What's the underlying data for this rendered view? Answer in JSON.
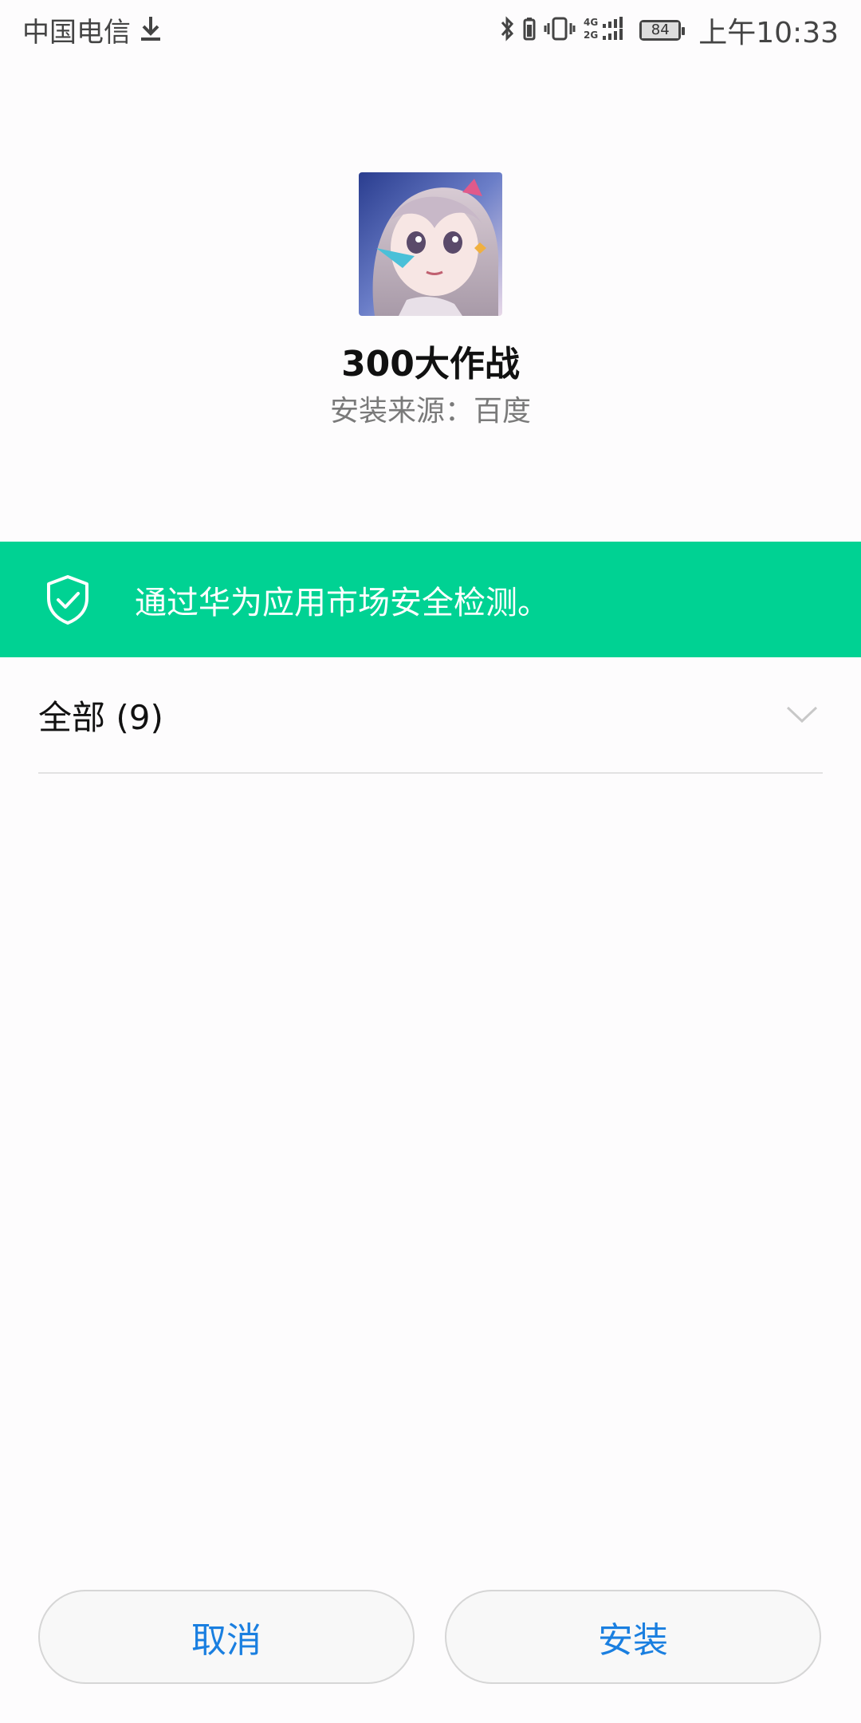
{
  "status_bar": {
    "carrier": "中国电信",
    "battery": "84",
    "time": "上午10:33",
    "network": "4G 2G"
  },
  "app": {
    "name": "300大作战",
    "install_source": "安装来源：百度"
  },
  "security": {
    "message": "通过华为应用市场安全检测。",
    "color": "#00d293"
  },
  "permissions": {
    "label": "全部 (9)"
  },
  "buttons": {
    "cancel": "取消",
    "install": "安装"
  },
  "colors": {
    "accent": "#1a7fe0"
  }
}
